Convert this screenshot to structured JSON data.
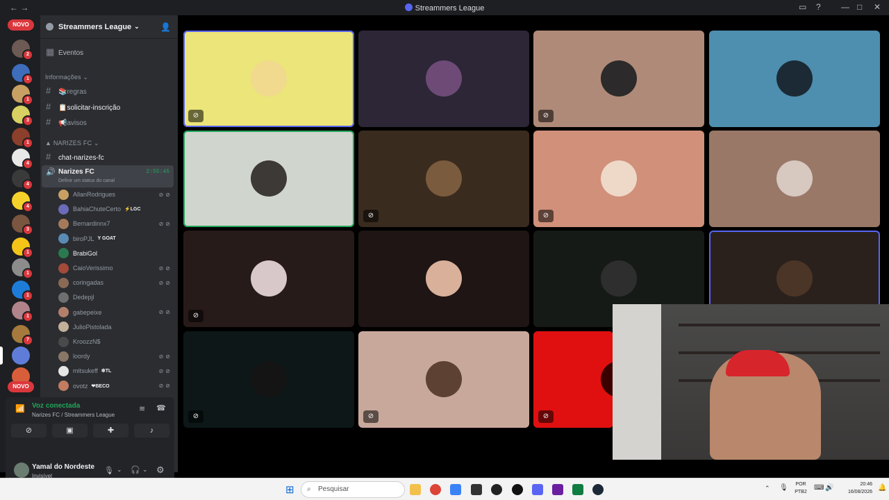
{
  "window": {
    "title": "Streammers League"
  },
  "server_list": {
    "novo_label": "NOVO",
    "badges": [
      "2",
      "1",
      "1",
      "3",
      "1",
      "4",
      "4",
      "4",
      "3",
      "1",
      "1",
      "1",
      "1",
      "7",
      "",
      ""
    ]
  },
  "server": {
    "name": "Streammers League",
    "events_label": "Eventos"
  },
  "channels": {
    "info_category": "Informações",
    "text": [
      {
        "name": "regras",
        "prefix": "📚"
      },
      {
        "name": "solicitar-inscrição",
        "prefix": "📋"
      },
      {
        "name": "avisos",
        "prefix": "📢"
      }
    ],
    "team_category": "NARIZES FC",
    "team_text_channel": "chat-narizes-fc",
    "voice_channel": {
      "name": "Narizes FC",
      "timer": "2:55:45",
      "status_hint": "Definir um status do canal"
    }
  },
  "members": [
    {
      "name": "AllanRodrigues",
      "tag": "",
      "muted": true
    },
    {
      "name": "BahiaChuteCerto",
      "tag": "⚡LGC",
      "muted": false
    },
    {
      "name": "Bernardinnx7",
      "tag": "",
      "muted": true
    },
    {
      "name": "biroPJL",
      "tag": "Y GOAT",
      "muted": false
    },
    {
      "name": "BrabiGol",
      "tag": "",
      "muted": false
    },
    {
      "name": "CaioVerissimo",
      "tag": "",
      "muted": true
    },
    {
      "name": "coringadas",
      "tag": "",
      "muted": true
    },
    {
      "name": "Dedepjl",
      "tag": "",
      "muted": false
    },
    {
      "name": "gabepeixe",
      "tag": "",
      "muted": true
    },
    {
      "name": "JulioPistolada",
      "tag": "",
      "muted": false
    },
    {
      "name": "KroozzN$",
      "tag": "",
      "muted": false
    },
    {
      "name": "loordy",
      "tag": "",
      "muted": true
    },
    {
      "name": "mitsukeff",
      "tag": "❇TL",
      "muted": true
    },
    {
      "name": "ovotz",
      "tag": "❤BECO",
      "muted": true
    }
  ],
  "voice_panel": {
    "status": "Voz conectada",
    "location": "Narizes FC / Streammers League"
  },
  "user_panel": {
    "name": "Yamal do Nordeste",
    "status": "Invisível"
  },
  "taskbar": {
    "search_placeholder": "Pesquisar",
    "lang": "POR",
    "layout": "PTB2",
    "time": "20:46",
    "date": "16/08/2026"
  },
  "tiles": [
    {
      "bg": "#ebe57a",
      "avatar": "#f1d98e",
      "muted": true,
      "border": "#5865f2"
    },
    {
      "bg": "#2c2637",
      "avatar": "#6e4a76",
      "muted": false,
      "border": ""
    },
    {
      "bg": "#b08a78",
      "avatar": "#2c2a2a",
      "muted": true,
      "border": ""
    },
    {
      "bg": "#4e8eaf",
      "avatar": "#1b2a35",
      "muted": false,
      "border": ""
    },
    {
      "bg": "#d0d5ce",
      "avatar": "#3d3936",
      "muted": false,
      "border": "#23a55a"
    },
    {
      "bg": "#3a2b1f",
      "avatar": "#7b5b3d",
      "muted": true,
      "border": ""
    },
    {
      "bg": "#d0907a",
      "avatar": "#eed8c8",
      "muted": true,
      "border": ""
    },
    {
      "bg": "#9a7868",
      "avatar": "#d7c8c0",
      "muted": false,
      "border": ""
    },
    {
      "bg": "#271b19",
      "avatar": "#d8c8ca",
      "muted": true,
      "border": ""
    },
    {
      "bg": "#1e1514",
      "avatar": "#d9b09a",
      "muted": false,
      "border": ""
    },
    {
      "bg": "#161a16",
      "avatar": "#2e2e2e",
      "muted": false,
      "border": ""
    },
    {
      "bg": "#2b211c",
      "avatar": "#4b3526",
      "muted": false,
      "border": "#5865f2"
    },
    {
      "bg": "#0d1718",
      "avatar": "#141414",
      "muted": true,
      "border": ""
    },
    {
      "bg": "#c9a89c",
      "avatar": "#5d4233",
      "muted": true,
      "border": ""
    },
    {
      "bg": "#e01010",
      "avatar": "#3b0000",
      "muted": true,
      "border": ""
    }
  ]
}
